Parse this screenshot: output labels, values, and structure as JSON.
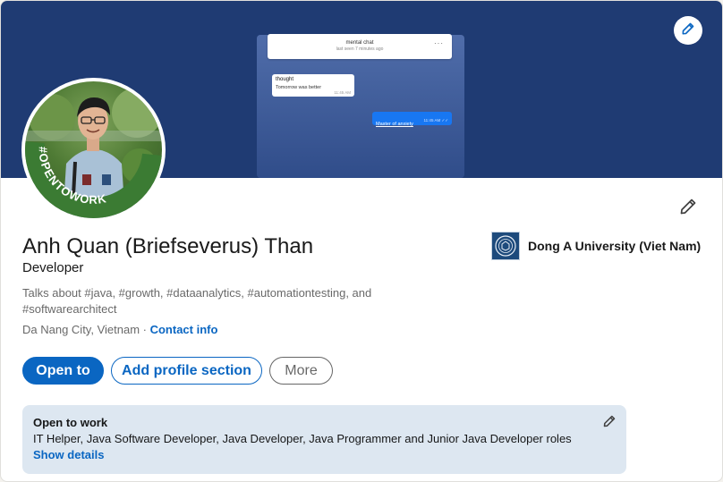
{
  "banner": {
    "chat_title": "mental chat",
    "chat_subtitle": "last seen 7 minutes ago",
    "chat_more": "···",
    "incoming_title": "thought",
    "incoming_text": "Tomorrow was better",
    "incoming_time": "11:45 AM",
    "outgoing_text": "Master of anxiety",
    "outgoing_time": "11:45 AM ✓✓",
    "edit_icon": "pencil-icon"
  },
  "avatar": {
    "badge_text": "#OPENTOWORK",
    "badge_color": "#3b7b33"
  },
  "profile": {
    "name": "Anh Quan (Briefseverus) Than",
    "headline": "Developer",
    "talks_about": "Talks about #java, #growth, #dataanalytics, #automationtesting, and #softwarearchitect",
    "location": "Da Nang City, Vietnam",
    "separator": " · ",
    "contact_info": "Contact info",
    "edit_icon": "pencil-icon"
  },
  "education": {
    "name": "Dong A University (Viet Nam)",
    "logo_icon": "university-logo-icon"
  },
  "actions": {
    "open_to": "Open to",
    "add_section": "Add profile section",
    "more": "More"
  },
  "open_to_work": {
    "title": "Open to work",
    "roles": "IT Helper, Java Software Developer, Java Developer, Java Programmer and Junior Java Developer roles",
    "show_details": "Show details",
    "edit_icon": "pencil-icon"
  },
  "colors": {
    "accent": "#0a66c2",
    "banner": "#1f3b73",
    "open_to_work_bg": "#dde7f1"
  }
}
